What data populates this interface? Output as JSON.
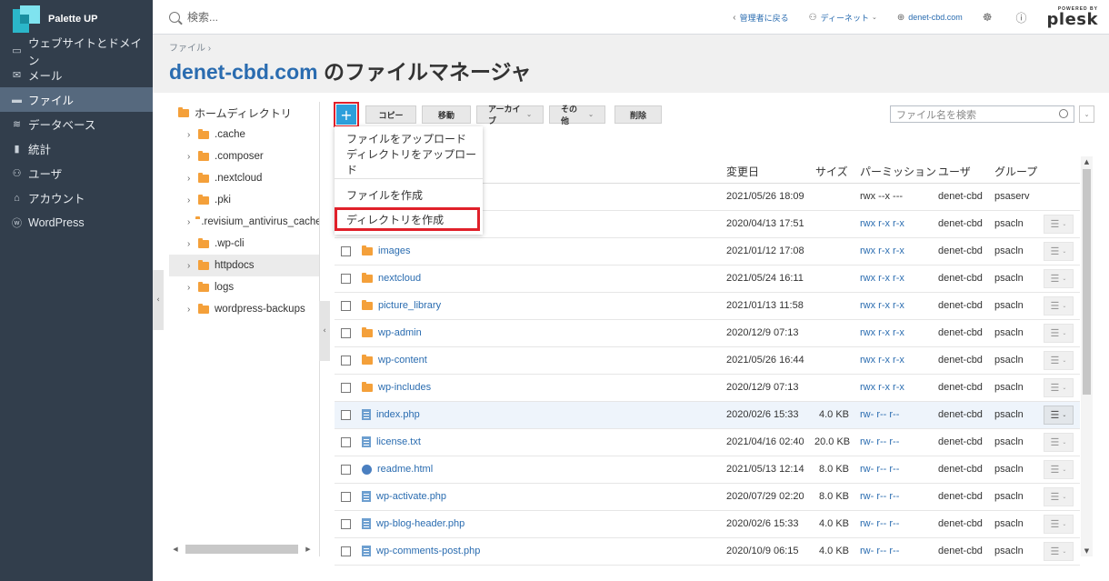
{
  "app": {
    "brand_name": "Palette UP",
    "brand_colors": [
      "#2bb6c9",
      "#7fe3ef",
      "#1a8fa1"
    ]
  },
  "nav": {
    "background": "#323e4c",
    "active_background": "#56697e",
    "items": [
      {
        "label": "ウェブサイトとドメイン",
        "icon": "monitor-icon"
      },
      {
        "label": "メール",
        "icon": "mail-icon"
      },
      {
        "label": "ファイル",
        "icon": "folder-icon",
        "active": true
      },
      {
        "label": "データベース",
        "icon": "database-icon"
      },
      {
        "label": "統計",
        "icon": "stats-icon"
      },
      {
        "label": "ユーザ",
        "icon": "user-icon"
      },
      {
        "label": "アカウント",
        "icon": "account-icon"
      },
      {
        "label": "WordPress",
        "icon": "wordpress-icon"
      }
    ]
  },
  "topbar": {
    "search_placeholder": "検索...",
    "back_to_admin": "管理者に戻る",
    "user_name": "ディーネット",
    "domain": "denet-cbd.com",
    "powered_by": "POWERED BY",
    "plesk": "plesk"
  },
  "header": {
    "breadcrumb": "ファイル",
    "title_domain": "denet-cbd.com",
    "title_suffix": "のファイルマネージャ"
  },
  "tree": {
    "root": "ホームディレクトリ",
    "items": [
      ".cache",
      ".composer",
      ".nextcloud",
      ".pki",
      ".revisium_antivirus_cache",
      ".wp-cli",
      "httpdocs",
      "logs",
      "wordpress-backups"
    ],
    "selected": "httpdocs"
  },
  "toolbar": {
    "add": "+",
    "copy": "コピー",
    "move": "移動",
    "archive": "アーカイブ",
    "more": "その他",
    "delete": "削除",
    "file_search_placeholder": "ファイル名を検索"
  },
  "add_menu": {
    "items": [
      "ファイルをアップロード",
      "ディレクトリをアップロード",
      "ファイルを作成",
      "ディレクトリを作成"
    ],
    "highlighted": "ディレクトリを作成",
    "highlight_color": "#e0202a"
  },
  "table": {
    "columns": {
      "modified": "変更日",
      "size": "サイズ",
      "permissions": "パーミッション",
      "owner": "ユーザ",
      "group": "グループ"
    },
    "rows": [
      {
        "name": "",
        "type": "hidden",
        "modified": "2021/05/26 18:09",
        "size": "",
        "permissions": "rwx --x ---",
        "perm_link": false,
        "owner": "denet-cbd",
        "group": "psaserv",
        "menu": false
      },
      {
        "name": "",
        "type": "hidden",
        "modified": "2020/04/13 17:51",
        "size": "",
        "permissions": "rwx r-x r-x",
        "perm_link": true,
        "owner": "denet-cbd",
        "group": "psacln",
        "menu": true
      },
      {
        "name": "images",
        "type": "folder",
        "modified": "2021/01/12 17:08",
        "size": "",
        "permissions": "rwx r-x r-x",
        "perm_link": true,
        "owner": "denet-cbd",
        "group": "psacln",
        "menu": true
      },
      {
        "name": "nextcloud",
        "type": "folder",
        "modified": "2021/05/24 16:11",
        "size": "",
        "permissions": "rwx r-x r-x",
        "perm_link": true,
        "owner": "denet-cbd",
        "group": "psacln",
        "menu": true
      },
      {
        "name": "picture_library",
        "type": "folder",
        "modified": "2021/01/13 11:58",
        "size": "",
        "permissions": "rwx r-x r-x",
        "perm_link": true,
        "owner": "denet-cbd",
        "group": "psacln",
        "menu": true
      },
      {
        "name": "wp-admin",
        "type": "folder",
        "modified": "2020/12/9 07:13",
        "size": "",
        "permissions": "rwx r-x r-x",
        "perm_link": true,
        "owner": "denet-cbd",
        "group": "psacln",
        "menu": true
      },
      {
        "name": "wp-content",
        "type": "folder",
        "modified": "2021/05/26 16:44",
        "size": "",
        "permissions": "rwx r-x r-x",
        "perm_link": true,
        "owner": "denet-cbd",
        "group": "psacln",
        "menu": true
      },
      {
        "name": "wp-includes",
        "type": "folder",
        "modified": "2020/12/9 07:13",
        "size": "",
        "permissions": "rwx r-x r-x",
        "perm_link": true,
        "owner": "denet-cbd",
        "group": "psacln",
        "menu": true
      },
      {
        "name": "index.php",
        "type": "file",
        "modified": "2020/02/6 15:33",
        "size": "4.0 KB",
        "permissions": "rw- r-- r--",
        "perm_link": true,
        "owner": "denet-cbd",
        "group": "psacln",
        "menu": true,
        "hover": true
      },
      {
        "name": "license.txt",
        "type": "file",
        "modified": "2021/04/16 02:40",
        "size": "20.0 KB",
        "permissions": "rw- r-- r--",
        "perm_link": true,
        "owner": "denet-cbd",
        "group": "psacln",
        "menu": true
      },
      {
        "name": "readme.html",
        "type": "html",
        "modified": "2021/05/13 12:14",
        "size": "8.0 KB",
        "permissions": "rw- r-- r--",
        "perm_link": true,
        "owner": "denet-cbd",
        "group": "psacln",
        "menu": true
      },
      {
        "name": "wp-activate.php",
        "type": "file",
        "modified": "2020/07/29 02:20",
        "size": "8.0 KB",
        "permissions": "rw- r-- r--",
        "perm_link": true,
        "owner": "denet-cbd",
        "group": "psacln",
        "menu": true
      },
      {
        "name": "wp-blog-header.php",
        "type": "file",
        "modified": "2020/02/6 15:33",
        "size": "4.0 KB",
        "permissions": "rw- r-- r--",
        "perm_link": true,
        "owner": "denet-cbd",
        "group": "psacln",
        "menu": true
      },
      {
        "name": "wp-comments-post.php",
        "type": "file",
        "modified": "2020/10/9 06:15",
        "size": "4.0 KB",
        "permissions": "rw- r-- r--",
        "perm_link": true,
        "owner": "denet-cbd",
        "group": "psacln",
        "menu": true
      }
    ]
  },
  "colors": {
    "link": "#2a6cb0",
    "add_button": "#2d9fdb",
    "folder": "#f4a03a"
  }
}
